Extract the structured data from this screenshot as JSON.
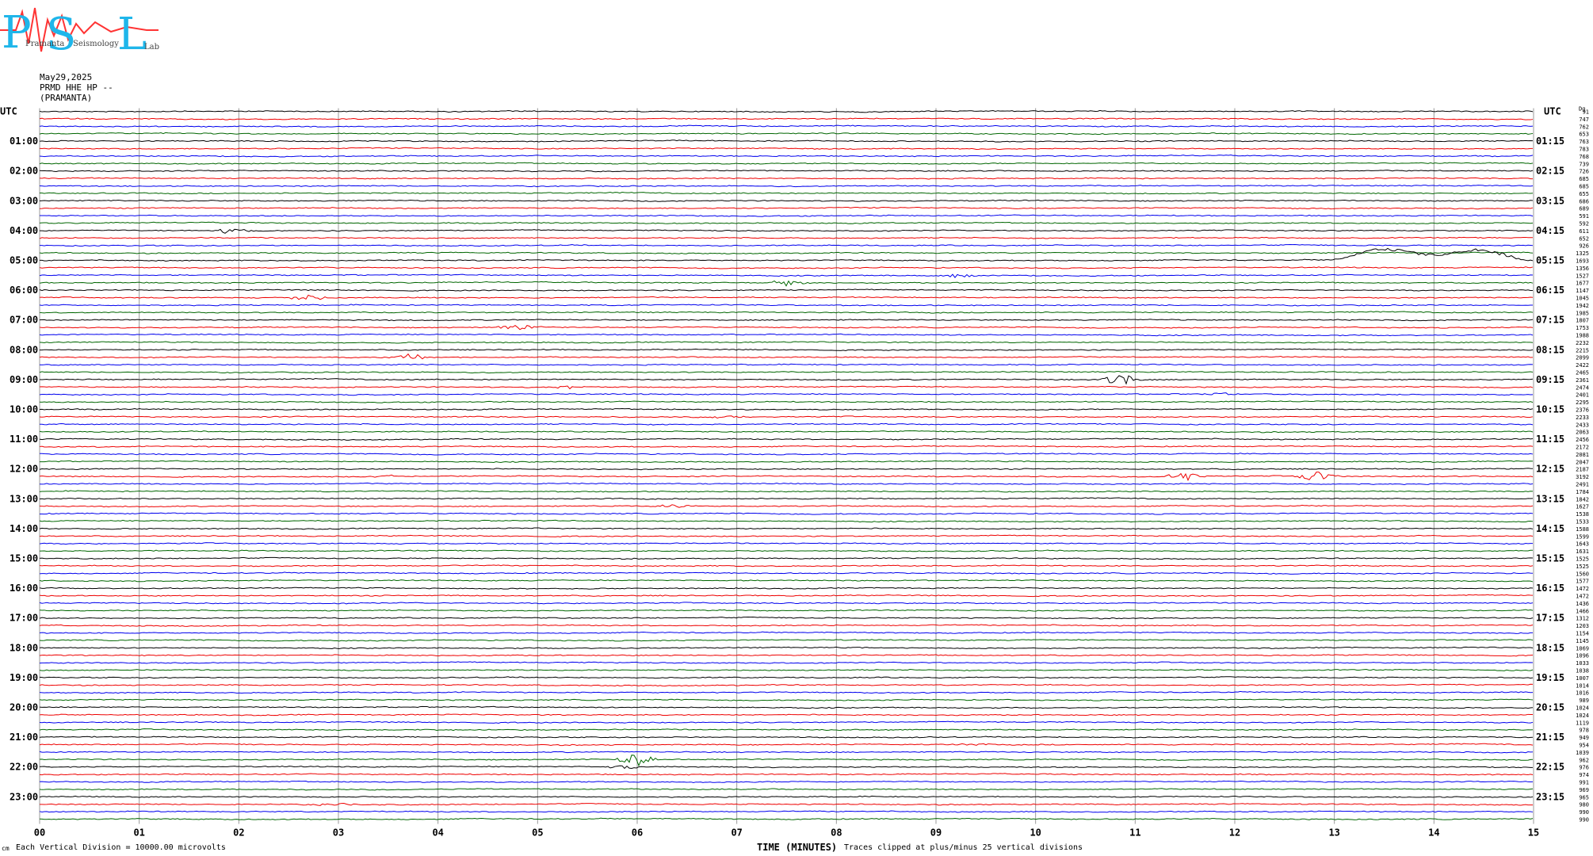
{
  "header": {
    "logo_letters": [
      "P",
      "S",
      "L"
    ],
    "logo_words": [
      "Pramanta",
      "Seismology",
      "Lab"
    ],
    "date": "May29,2025",
    "station": "PRMD HHE HP --",
    "site": "(PRAMANTA)"
  },
  "footer": {
    "scale_note": "Each Vertical Division = 10000.00 microvolts",
    "xlabel": "TIME (MINUTES)",
    "clip_note": "Traces clipped at plus/minus 25 vertical divisions",
    "corner": "cm"
  },
  "colors": {
    "trace_cycle": [
      "#000000",
      "#ee0000",
      "#0000ee",
      "#006600"
    ],
    "grid": "#999999"
  },
  "chart_data": {
    "type": "line",
    "title": "",
    "left_axis_label": "UTC",
    "right_axis_label": "UTC",
    "corner_label": "Dg",
    "x_ticks": [
      "00",
      "01",
      "02",
      "03",
      "04",
      "05",
      "06",
      "07",
      "08",
      "09",
      "10",
      "11",
      "12",
      "13",
      "14",
      "15"
    ],
    "xlim": [
      0,
      15
    ],
    "trace_count": 96,
    "left_hour_labels": [
      "01:00",
      "02:00",
      "03:00",
      "04:00",
      "05:00",
      "06:00",
      "07:00",
      "08:00",
      "09:00",
      "10:00",
      "11:00",
      "12:00",
      "13:00",
      "14:00",
      "15:00",
      "16:00",
      "17:00",
      "18:00",
      "19:00",
      "20:00",
      "21:00",
      "22:00",
      "23:00"
    ],
    "right_hour_labels": [
      "01:15",
      "02:15",
      "03:15",
      "04:15",
      "05:15",
      "06:15",
      "07:15",
      "08:15",
      "09:15",
      "10:15",
      "11:15",
      "12:15",
      "13:15",
      "14:15",
      "15:15",
      "16:15",
      "17:15",
      "18:15",
      "19:15",
      "20:15",
      "21:15",
      "22:15",
      "23:15"
    ],
    "trace_values": [
      "91",
      "747",
      "762",
      "653",
      "763",
      "783",
      "768",
      "739",
      "726",
      "685",
      "685",
      "655",
      "686",
      "689",
      "591",
      "592",
      "611",
      "652",
      "926",
      "1325",
      "1693",
      "1356",
      "1527",
      "1677",
      "1147",
      "1045",
      "1942",
      "1985",
      "1807",
      "1753",
      "1988",
      "2232",
      "2215",
      "2099",
      "2422",
      "2465",
      "2361",
      "2474",
      "2401",
      "2295",
      "2376",
      "2233",
      "2433",
      "2063",
      "2456",
      "2172",
      "2081",
      "2047",
      "2187",
      "3192",
      "2491",
      "1784",
      "1842",
      "1627",
      "1538",
      "1533",
      "1588",
      "1599",
      "1643",
      "1631",
      "1525",
      "1525",
      "1560",
      "1577",
      "1472",
      "1472",
      "1436",
      "1466",
      "1312",
      "1203",
      "1154",
      "1145",
      "1069",
      "1096",
      "1033",
      "1038",
      "1007",
      "1014",
      "1016",
      "989",
      "1024",
      "1024",
      "1119",
      "978",
      "949",
      "954",
      "1039",
      "962",
      "976",
      "974",
      "991",
      "969",
      "965",
      "980",
      "990",
      "990"
    ],
    "events": [
      {
        "trace": 16,
        "minute": 1.9,
        "amp": 4
      },
      {
        "trace": 20,
        "minute": 13.3,
        "amp": 14,
        "kind": "drift"
      },
      {
        "trace": 22,
        "minute": 9.2,
        "amp": 3
      },
      {
        "trace": 23,
        "minute": 7.5,
        "amp": 4
      },
      {
        "trace": 25,
        "minute": 2.7,
        "amp": 4
      },
      {
        "trace": 29,
        "minute": 4.8,
        "amp": 4
      },
      {
        "trace": 33,
        "minute": 3.7,
        "amp": 5
      },
      {
        "trace": 36,
        "minute": 10.85,
        "amp": 8
      },
      {
        "trace": 37,
        "minute": 5.3,
        "amp": 2
      },
      {
        "trace": 38,
        "minute": 11.8,
        "amp": 2
      },
      {
        "trace": 41,
        "minute": 6.9,
        "amp": 2
      },
      {
        "trace": 49,
        "minute": 11.5,
        "amp": 6
      },
      {
        "trace": 49,
        "minute": 12.8,
        "amp": 7
      },
      {
        "trace": 49,
        "minute": 3.5,
        "amp": 2
      },
      {
        "trace": 53,
        "minute": 6.35,
        "amp": 2
      },
      {
        "trace": 85,
        "minute": 9.4,
        "amp": 1.5
      },
      {
        "trace": 87,
        "minute": 6.0,
        "amp": 8
      },
      {
        "trace": 88,
        "minute": 5.9,
        "amp": 3
      },
      {
        "trace": 93,
        "minute": 2.95,
        "amp": 2
      }
    ]
  }
}
